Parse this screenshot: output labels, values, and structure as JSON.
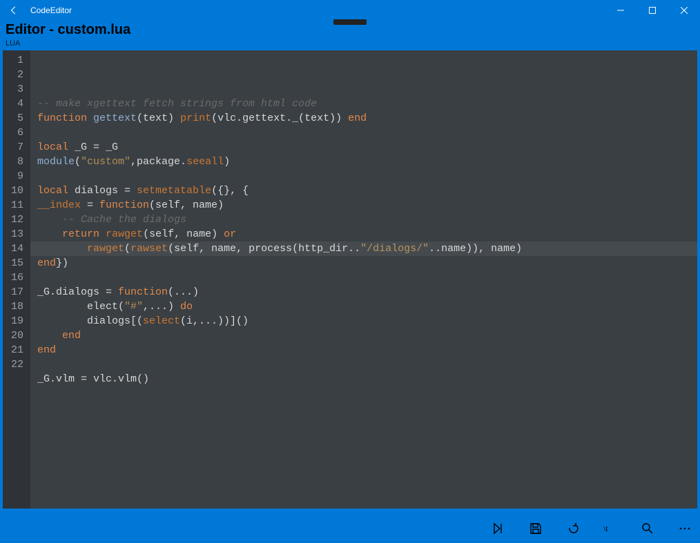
{
  "titlebar": {
    "app_name": "CodeEditor"
  },
  "header": {
    "title": "Editor - custom.lua",
    "language": "LUA"
  },
  "code_lines": [
    [
      {
        "c": "c-comment",
        "t": "-- make xgettext fetch strings from html code"
      }
    ],
    [
      {
        "c": "c-keyword",
        "t": "function"
      },
      {
        "c": "",
        "t": " "
      },
      {
        "c": "c-func",
        "t": "gettext"
      },
      {
        "c": "",
        "t": "(text) "
      },
      {
        "c": "c-builtin",
        "t": "print"
      },
      {
        "c": "",
        "t": "(vlc.gettext._(text)) "
      },
      {
        "c": "c-keyword",
        "t": "end"
      }
    ],
    [],
    [
      {
        "c": "c-keyword",
        "t": "local"
      },
      {
        "c": "",
        "t": " _G = _G"
      }
    ],
    [
      {
        "c": "c-func",
        "t": "module"
      },
      {
        "c": "",
        "t": "("
      },
      {
        "c": "c-string",
        "t": "\"custom\""
      },
      {
        "c": "",
        "t": ",package."
      },
      {
        "c": "c-builtin",
        "t": "seeall"
      },
      {
        "c": "",
        "t": ")"
      }
    ],
    [],
    [
      {
        "c": "c-keyword",
        "t": "local"
      },
      {
        "c": "",
        "t": " dialogs = "
      },
      {
        "c": "c-builtin",
        "t": "setmetatable"
      },
      {
        "c": "",
        "t": "({}, {"
      }
    ],
    [
      {
        "c": "c-builtin",
        "t": "__index"
      },
      {
        "c": "",
        "t": " = "
      },
      {
        "c": "c-keyword",
        "t": "function"
      },
      {
        "c": "",
        "t": "(self, name)"
      }
    ],
    [
      {
        "c": "",
        "t": "    "
      },
      {
        "c": "c-comment",
        "t": "-- Cache the dialogs"
      }
    ],
    [
      {
        "c": "",
        "t": "    "
      },
      {
        "c": "c-keyword",
        "t": "return"
      },
      {
        "c": "",
        "t": " "
      },
      {
        "c": "c-builtin",
        "t": "rawget"
      },
      {
        "c": "",
        "t": "(self, name) "
      },
      {
        "c": "c-keyword",
        "t": "or"
      }
    ],
    [
      {
        "c": "",
        "t": "        "
      },
      {
        "c": "c-builtin",
        "t": "rawget"
      },
      {
        "c": "",
        "t": "("
      },
      {
        "c": "c-builtin",
        "t": "rawset"
      },
      {
        "c": "",
        "t": "(self, name, process(http_dir.."
      },
      {
        "c": "c-string",
        "t": "\"/dialogs/\""
      },
      {
        "c": "",
        "t": "..name)), name)"
      }
    ],
    [
      {
        "c": "c-keyword",
        "t": "end"
      },
      {
        "c": "",
        "t": "})"
      }
    ],
    [],
    [
      {
        "c": "",
        "t": "_G.dialogs = "
      },
      {
        "c": "c-keyword",
        "t": "function"
      },
      {
        "c": "",
        "t": "(...)"
      }
    ],
    [
      {
        "c": "",
        "t": "        elect("
      },
      {
        "c": "c-string",
        "t": "\"#\""
      },
      {
        "c": "",
        "t": ",...) "
      },
      {
        "c": "c-keyword",
        "t": "do"
      }
    ],
    [
      {
        "c": "",
        "t": "        dialogs[("
      },
      {
        "c": "c-builtin",
        "t": "select"
      },
      {
        "c": "",
        "t": "(i,...))]()"
      }
    ],
    [
      {
        "c": "",
        "t": "    "
      },
      {
        "c": "c-keyword",
        "t": "end"
      }
    ],
    [
      {
        "c": "c-keyword",
        "t": "end"
      }
    ],
    [],
    [
      {
        "c": "",
        "t": "_G.vlm = vlc.vlm()"
      }
    ],
    [],
    []
  ],
  "line_count": 22
}
